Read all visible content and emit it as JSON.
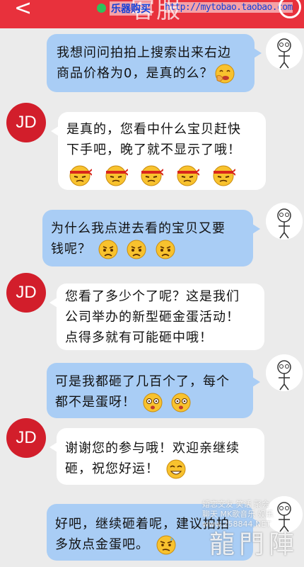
{
  "header": {
    "back_glyph": "<",
    "title_fragment": "客服",
    "shop_watermark": "乐器购买",
    "shop_url": "http://mytobao.taobao.com",
    "bg_color": "#e8313c"
  },
  "messages": [
    {
      "sender": "user",
      "lines": [
        "我想问问拍拍上搜索出来右边",
        "商品价格为0，是真的么？"
      ],
      "emojis": [
        "giggle-emoji"
      ]
    },
    {
      "sender": "agent",
      "avatar_text": "JD",
      "lines": [
        "是真的，您看中什么宝贝赶快",
        "下手吧，晚了就不显示了哦！"
      ],
      "emojis": [
        "fighting-emoji",
        "fighting-emoji",
        "fighting-emoji",
        "fighting-emoji",
        "fighting-emoji"
      ]
    },
    {
      "sender": "user",
      "lines": [
        "为什么我点进去看的宝贝又要",
        "钱呢？"
      ],
      "emojis": [
        "sad-emoji",
        "sad-emoji",
        "sad-emoji"
      ]
    },
    {
      "sender": "agent",
      "avatar_text": "JD",
      "lines": [
        "您看了多少个了呢？这是我们",
        "公司举办的新型砸金蛋活动！",
        "点得多就有可能砸中哦！"
      ],
      "emojis": []
    },
    {
      "sender": "user",
      "lines": [
        "可是我都砸了几百个了，每个",
        "都不是蛋呀！"
      ],
      "emojis": [
        "shocked-emoji",
        "shocked-emoji"
      ]
    },
    {
      "sender": "agent",
      "avatar_text": "JD",
      "lines": [
        "谢谢您的参与哦！欢迎亲继续",
        "砸，祝您好运！"
      ],
      "emojis": [
        "grin-emoji"
      ]
    },
    {
      "sender": "user",
      "lines": [
        "好吧，继续砸着呢，建议拍拍",
        "多放点金蛋吧。"
      ],
      "emojis": [
        "annoyed-emoji"
      ]
    }
  ],
  "watermark": {
    "line1": "婚恋交友 笑话 聚会",
    "line2": "聊天 MK歌音乐 娱乐",
    "line3": "www.258844.NET",
    "logo": "龍門陣"
  },
  "colors": {
    "user_bubble": "#a9cdf5",
    "agent_bubble": "#ffffff",
    "jd_avatar": "#d21e2b",
    "background": "#ebebeb"
  }
}
